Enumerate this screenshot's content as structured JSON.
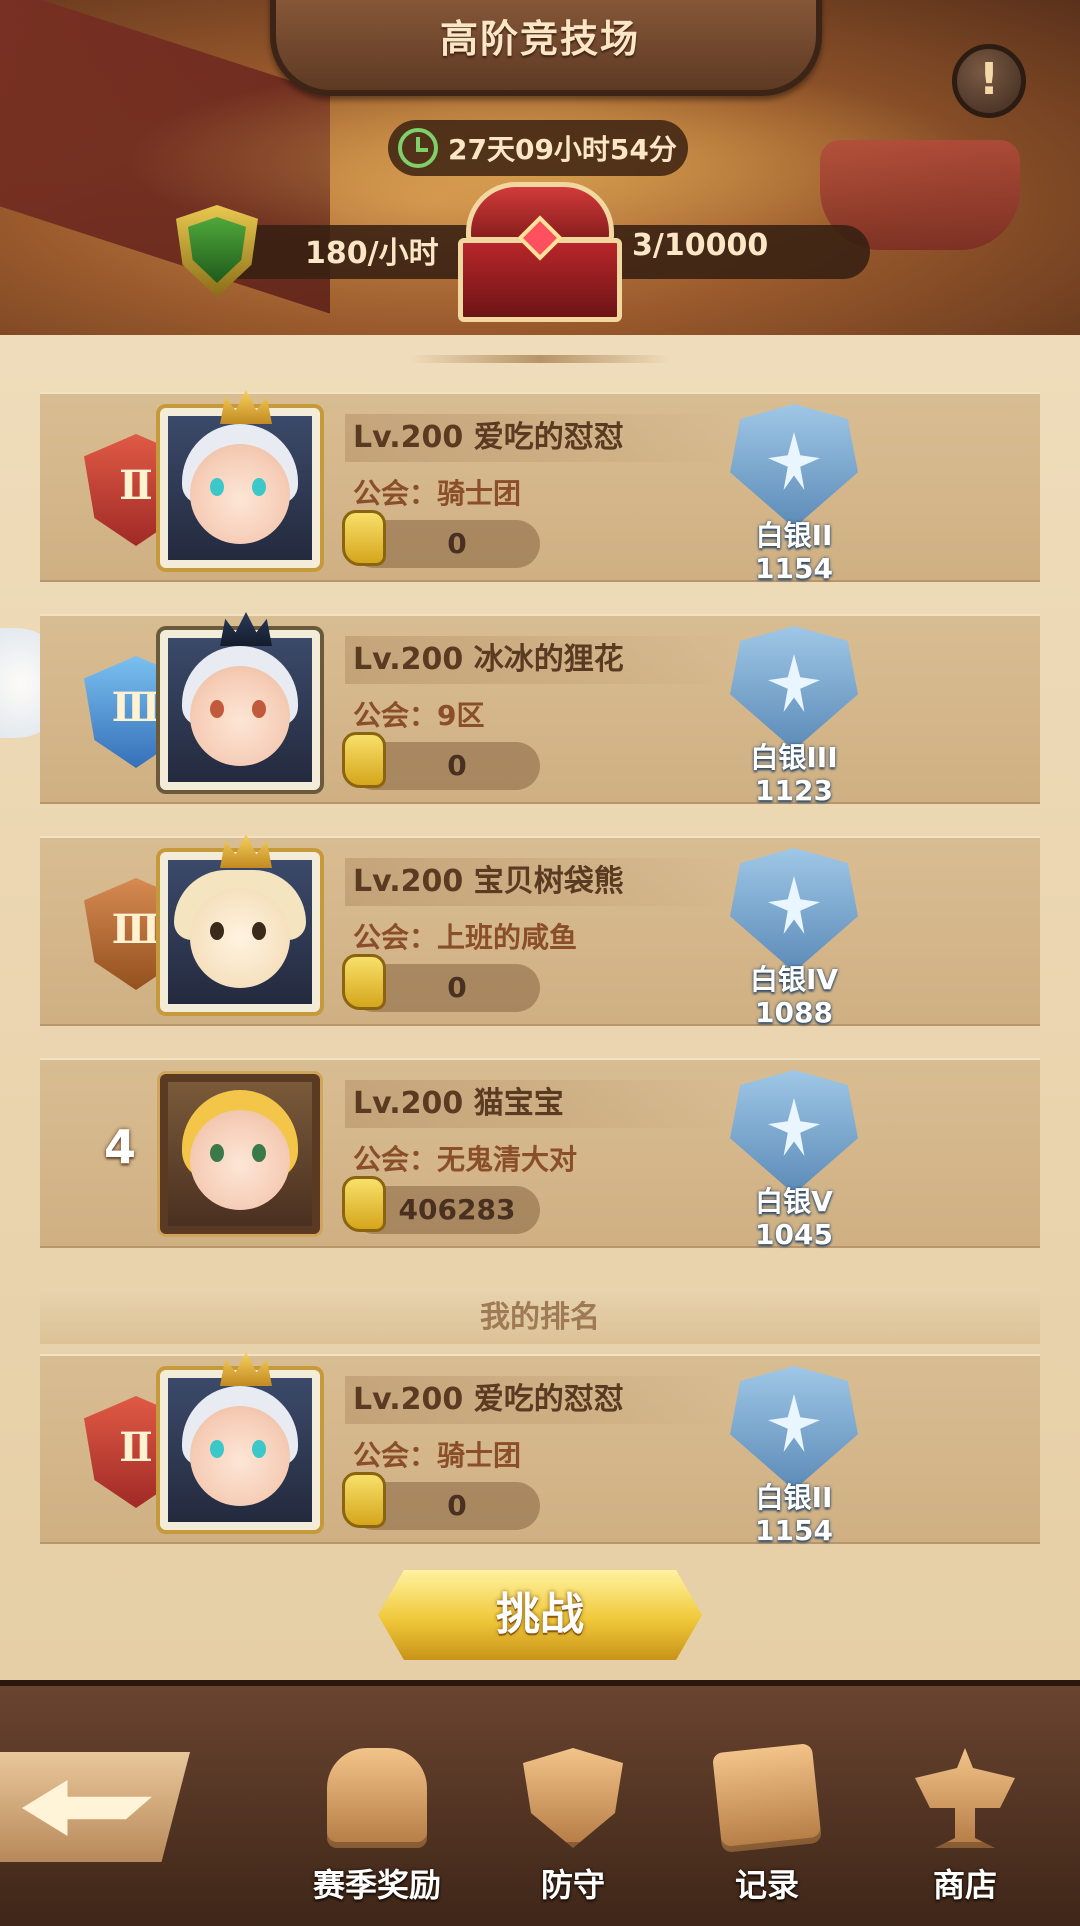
{
  "header": {
    "title": "高阶竞技场",
    "timer": "27天09小时54分",
    "rate": "180/小时",
    "chest_count": "3/10000",
    "info_icon": "exclamation-icon"
  },
  "rankings": [
    {
      "rank": 1,
      "rank_display": "Ⅱ",
      "badge": "gold-rank-badge",
      "name": "Lv.200 爱吃的怼怼",
      "guild": "公会：骑士团",
      "power": "0",
      "tier": "白银II",
      "score": "1154"
    },
    {
      "rank": 2,
      "rank_display": "Ⅲ",
      "badge": "silver-rank-badge",
      "name": "Lv.200 冰冰的狸花",
      "guild": "公会：9区",
      "power": "0",
      "tier": "白银III",
      "score": "1123"
    },
    {
      "rank": 3,
      "rank_display": "Ⅲ",
      "badge": "bronze-rank-badge",
      "name": "Lv.200 宝贝树袋熊",
      "guild": "公会：上班的咸鱼",
      "power": "0",
      "tier": "白银IV",
      "score": "1088"
    },
    {
      "rank": 4,
      "rank_display": "4",
      "name": "Lv.200 猫宝宝",
      "guild": "公会：无鬼清大对",
      "power": "406283",
      "tier": "白银V",
      "score": "1045"
    }
  ],
  "my_rank": {
    "header": "我的排名",
    "name": "Lv.200 爱吃的怼怼",
    "guild": "公会：骑士团",
    "power": "0",
    "tier": "白银II",
    "score": "1154"
  },
  "challenge_label": "挑战",
  "nav": [
    {
      "label": "赛季奖励",
      "icon": "chest-icon"
    },
    {
      "label": "防守",
      "icon": "shield-icon"
    },
    {
      "label": "记录",
      "icon": "scroll-icon"
    },
    {
      "label": "商店",
      "icon": "scale-icon"
    }
  ],
  "colors": {
    "accent": "#f0c83a",
    "panel": "#e6cfa6",
    "tier": "#5c8bb8"
  }
}
